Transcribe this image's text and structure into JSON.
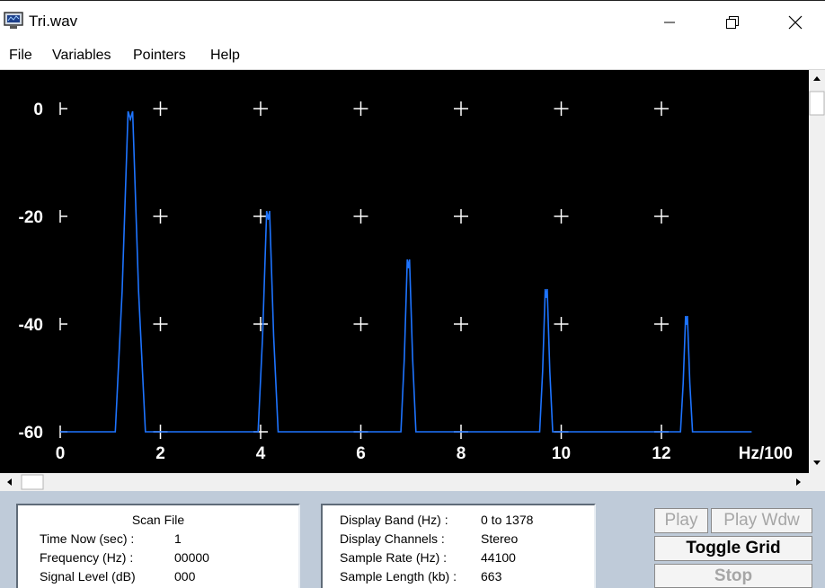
{
  "window": {
    "title": "Tri.wav",
    "icons": {
      "app": "monitor-icon",
      "minimize": "minimize-icon",
      "maximize": "restore-icon",
      "close": "close-icon"
    }
  },
  "menu": [
    "File",
    "Variables",
    "Pointers",
    "Help"
  ],
  "chart_data": {
    "type": "line",
    "xlabel": "Hz/100",
    "ylabel": "",
    "x_ticks": [
      "0",
      "2",
      "4",
      "6",
      "8",
      "10",
      "12"
    ],
    "y_ticks": [
      "0",
      "-20",
      "-40",
      "-60"
    ],
    "xlim": [
      0,
      14.5
    ],
    "ylim": [
      -60,
      0
    ],
    "grid": true,
    "background": "#000000",
    "line_color": "#1e74ff",
    "baseline_end_x": 13.8,
    "peaks": [
      {
        "x": 1.4,
        "y": -2,
        "half_width": 0.3
      },
      {
        "x": 4.15,
        "y": -20.5,
        "half_width": 0.2
      },
      {
        "x": 6.95,
        "y": -29.5,
        "half_width": 0.15
      },
      {
        "x": 9.7,
        "y": -35,
        "half_width": 0.13
      },
      {
        "x": 12.5,
        "y": -40,
        "half_width": 0.12
      }
    ]
  },
  "scan_panel": {
    "title": "Scan File",
    "rows": [
      {
        "label": "Time Now (sec) :",
        "value": "1"
      },
      {
        "label": "Frequency (Hz) :",
        "value": "00000"
      },
      {
        "label": "Signal Level (dB)",
        "value": "000"
      }
    ]
  },
  "info_panel": {
    "rows": [
      {
        "label": "Display Band (Hz) :",
        "value": "0 to 1378"
      },
      {
        "label": "Display Channels :",
        "value": "Stereo"
      },
      {
        "label": "Sample Rate (Hz) :",
        "value": "44100"
      },
      {
        "label": "Sample Length (kb) :",
        "value": "663"
      }
    ]
  },
  "buttons": {
    "play": "Play",
    "play_window": "Play Wdw",
    "toggle_grid": "Toggle Grid",
    "stop": "Stop"
  }
}
